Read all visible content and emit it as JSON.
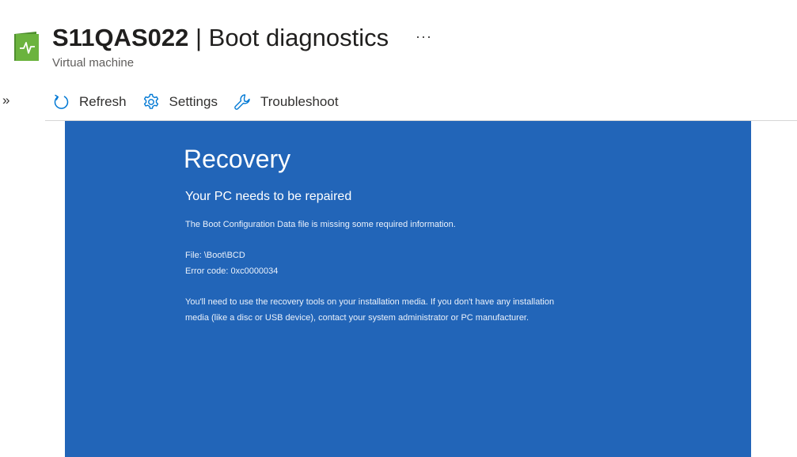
{
  "header": {
    "vm_name": "S11QAS022",
    "separator": " | ",
    "page_name": "Boot diagnostics",
    "subtitle": "Virtual machine",
    "more_label": "···"
  },
  "nav": {
    "expand_label": "»"
  },
  "toolbar": {
    "refresh_label": "Refresh",
    "settings_label": "Settings",
    "troubleshoot_label": "Troubleshoot"
  },
  "screenshot": {
    "title": "Recovery",
    "subtitle": "Your PC needs to be repaired",
    "message": "The Boot Configuration Data file is missing some required information.",
    "file": "File: \\Boot\\BCD",
    "error_code": "Error code: 0xc0000034",
    "instructions_line1": "You'll need to use the recovery tools on your installation media. If you don't have any installation",
    "instructions_line2": "media (like a disc or USB device), contact your system administrator or PC manufacturer."
  },
  "colors": {
    "recovery_bg": "#2265b8",
    "icon_accent": "#0078d4",
    "vm_icon_green": "#5ea33a"
  },
  "icons": [
    "vm-icon",
    "refresh-icon",
    "gear-icon",
    "wrench-icon"
  ]
}
